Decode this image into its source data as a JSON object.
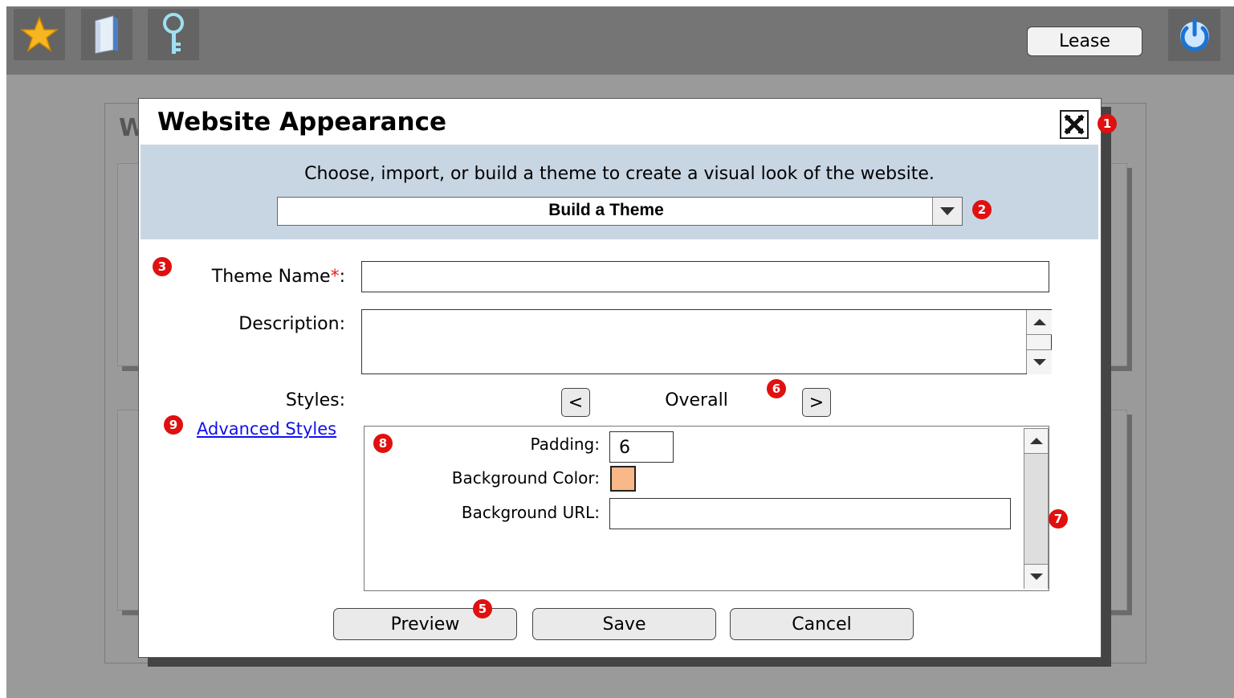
{
  "toolbar": {
    "icons": [
      "star-icon",
      "book-icon",
      "key-icon",
      "power-icon"
    ],
    "lease_label": "Lease"
  },
  "background": {
    "heading_fragment": "W"
  },
  "dialog": {
    "title": "Website Appearance",
    "instruction": "Choose, import, or build a theme to create a visual look of the website.",
    "theme_select": {
      "value": "Build a Theme"
    },
    "theme_name_label": "Theme Name",
    "required_marker": "*",
    "theme_name_colon": ":",
    "theme_name_value": "",
    "description_label": "Description:",
    "description_value": "",
    "styles_label": "Styles:",
    "advanced_styles_link": "Advanced Styles",
    "styles_nav": {
      "prev": "<",
      "current": "Overall",
      "next": ">"
    },
    "styles_panel": {
      "padding_label": "Padding:",
      "padding_value": "6",
      "bg_color_label": "Background Color:",
      "bg_color_value": "#f9b887",
      "bg_url_label": "Background URL:",
      "bg_url_value": ""
    },
    "buttons": {
      "preview": "Preview",
      "save": "Save",
      "cancel": "Cancel"
    }
  },
  "annotations": [
    "1",
    "2",
    "3",
    "5",
    "6",
    "7",
    "8",
    "9"
  ],
  "colors": {
    "toolbar": "#757575",
    "banner": "#c8d6e4",
    "badge": "#e01010",
    "link": "#1010ee"
  }
}
